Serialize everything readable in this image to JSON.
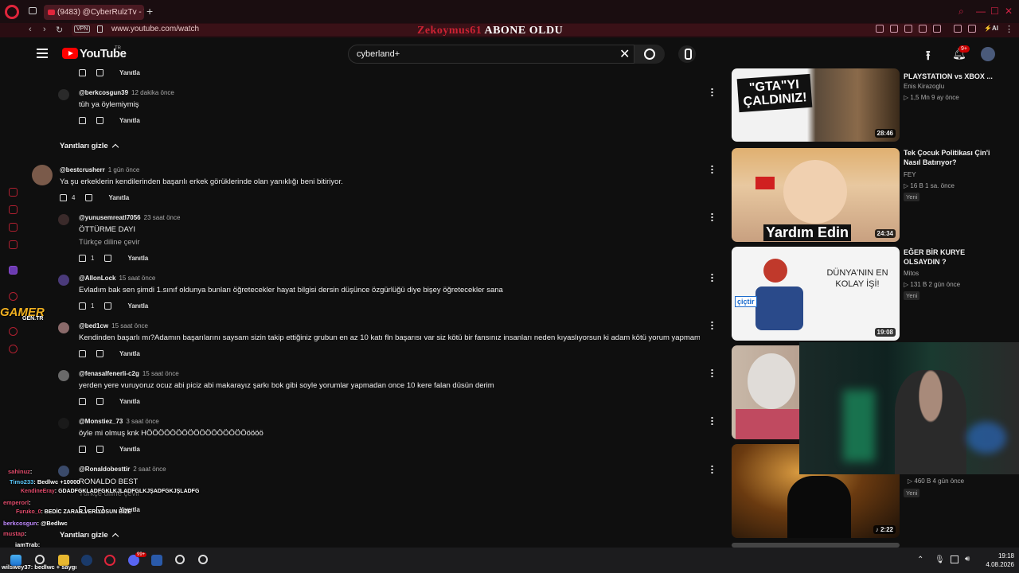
{
  "browser": {
    "tab_title": "(9483) @CyberRulzTv - YE",
    "new_tab": "+",
    "vpn": "VPN",
    "url": "www.youtube.com/watch",
    "banner_name": "Zekoymus61",
    "banner_text": "ABONE OLDU"
  },
  "youtube": {
    "logo_text": "YouTube",
    "logo_country": "TR",
    "search_value": "cyberland+",
    "clear_icon": "✕",
    "notif_count": "9+"
  },
  "comments": {
    "reply_label": "Yanıtla",
    "hide_replies": "Yanıtları gizle",
    "items": [
      {
        "author": "@berkcosgun39",
        "time": "12 dakika önce",
        "text": "tüh ya öylemiymiş",
        "likes": ""
      },
      {
        "author": "@bestcrusherr",
        "time": "1 gün önce",
        "text": "Ya şu erkeklerin kendilerinden başarılı erkek görüklerinde olan yanıklığı beni bitiriyor.",
        "likes": "4"
      },
      {
        "author": "@yunusemreatl7056",
        "time": "23 saat önce",
        "text": "ÖTTÜRME DAYI",
        "translate": "Türkçe diline çevir",
        "likes": "1"
      },
      {
        "author": "@AllonLock",
        "time": "15 saat önce",
        "text": "Evladım bak sen şimdi 1.sınıf oldunya bunları öğretecekler hayat bilgisi dersin düşünce özgürlüğü diye bişey öğretecekler sana",
        "likes": "1"
      },
      {
        "author": "@bed1cw",
        "time": "15 saat önce",
        "text": "Kendinden başarlı mı?Adamın başarılarını saysam sizin takip ettiğiniz grubun en az 10 katı fln başarısı var siz kötü bir fansınız insanları neden kıyaslıyorsun ki adam kötü yorum yapmamış",
        "likes": ""
      },
      {
        "author": "@fenasalfenerli-c2g",
        "time": "15 saat önce",
        "text": "yerden yere vuruyoruz ocuz abi piciz abi makarayız şarkı bok gibi  soyle yorumlar yapmadan once 10 kere falan düsün derim",
        "likes": ""
      },
      {
        "author": "@Monstiez_73",
        "time": "3 saat önce",
        "text": "öyle mi olmuş knk HÖÖÖÖÖÖÖÖÖÖÖÖÖÖÖÖÖöööö",
        "likes": ""
      },
      {
        "author": "@Ronaldobesttir",
        "time": "2 saat önce",
        "text": "RONALDO BEST",
        "translate": "Türkçe diline çevir",
        "likes": ""
      }
    ]
  },
  "sidebar": {
    "videos": [
      {
        "title": "PLAYSTATION vs XBOX ...",
        "channel": "Enis Kirazoglu",
        "meta": "▷ 1,5 Mn  9 ay önce",
        "duration": "28:46",
        "thumb_text": "\"GTA\"YI ÇALDINIZ!",
        "badge": ""
      },
      {
        "title": "Tek Çocuk Politikası Çin'i Nasıl Batırıyor?",
        "channel": "FEY",
        "meta": "▷ 16 B  1 sa. önce",
        "duration": "24:34",
        "thumb_text": "Yardım Edin",
        "badge": "Yeni"
      },
      {
        "title": "EĞER BİR KURYE OLSAYDIN ?",
        "channel": "Mitos",
        "meta": "▷ 131 B  2 gün önce",
        "duration": "19:08",
        "thumb_text": "DÜNYA'NIN EN KOLAY İŞİ!",
        "thumb_logo": "çiçtir",
        "badge": "Yeni"
      },
      {
        "title": "",
        "channel": "",
        "meta": "▷ 460 B  4 gün önce",
        "duration": "2:22",
        "badge": "Yeni"
      }
    ]
  },
  "overlay": {
    "gamer_logo": "GAMER",
    "gamer_sub": "GEN.TR",
    "chat": [
      {
        "user": "sahinuz",
        "msg": ":"
      },
      {
        "user": "Timo233",
        "msg": ": Bedlwc +10000"
      },
      {
        "user": "KendineEray",
        "msg": ": GDADFGKLADFGKLKJLADFGLKJŞADFGKJŞLADFG"
      },
      {
        "user": "emperorl",
        "msg": ":"
      },
      {
        "user": "Furuko_0",
        "msg": ": BEDİC ZARAR VERİYOSUN BİZE"
      },
      {
        "user": "berkcosgun",
        "msg": ": @Bedlwc"
      },
      {
        "user": "mustap",
        "msg": ":"
      },
      {
        "user": "iamTrab",
        "msg": ":"
      },
      {
        "user": "wilswey37",
        "msg": ": bedlwc + saygı"
      }
    ]
  },
  "taskbar": {
    "time": "19:18",
    "date": "4.08.2026",
    "chrome_badge": "99+"
  }
}
